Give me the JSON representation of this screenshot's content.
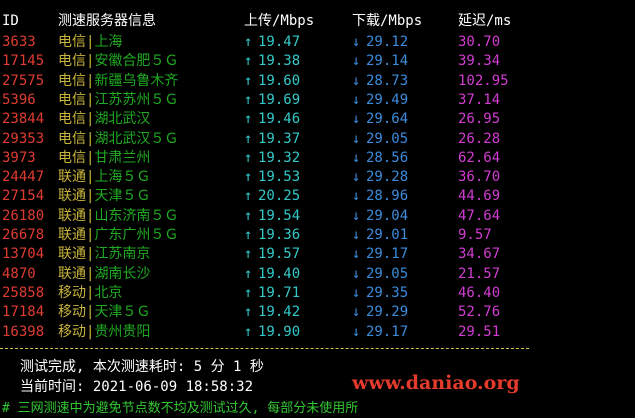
{
  "colors": {
    "background": "#000000",
    "header": "#ffffff",
    "id_red": "#e03c32",
    "isp_gold": "#c8b43c",
    "node_green": "#1faa22",
    "up_cyan": "#33c8c8",
    "down_blue": "#3c8cdc",
    "latency_magenta": "#d23cd2",
    "separator": "#d8c24a",
    "watermark": "#e53b2c",
    "note": "#33c833"
  },
  "header": {
    "id": "ID",
    "node": "测速服务器信息",
    "upload": "上传/Mbps",
    "download": "下载/Mbps",
    "latency": "延迟/ms"
  },
  "arrow_up": "↑",
  "arrow_down": "↓",
  "rows": [
    {
      "id": "3633",
      "isp": "电信",
      "sep": "|",
      "city": "上海",
      "up": "19.47",
      "down": "29.12",
      "latency": "30.70"
    },
    {
      "id": "17145",
      "isp": "电信",
      "sep": "|",
      "city": "安徽合肥５Ｇ",
      "up": "19.38",
      "down": "29.14",
      "latency": "39.34"
    },
    {
      "id": "27575",
      "isp": "电信",
      "sep": "|",
      "city": "新疆乌鲁木齐",
      "up": "19.60",
      "down": "28.73",
      "latency": "102.95"
    },
    {
      "id": "5396",
      "isp": "电信",
      "sep": "|",
      "city": "江苏苏州５Ｇ",
      "up": "19.69",
      "down": "29.49",
      "latency": "37.14"
    },
    {
      "id": "23844",
      "isp": "电信",
      "sep": "|",
      "city": "湖北武汉",
      "up": "19.46",
      "down": "29.64",
      "latency": "26.95"
    },
    {
      "id": "29353",
      "isp": "电信",
      "sep": "|",
      "city": "湖北武汉５Ｇ",
      "up": "19.37",
      "down": "29.05",
      "latency": "26.28"
    },
    {
      "id": "3973",
      "isp": "电信",
      "sep": "|",
      "city": "甘肃兰州",
      "up": "19.32",
      "down": "28.56",
      "latency": "62.64"
    },
    {
      "id": "24447",
      "isp": "联通",
      "sep": "|",
      "city": "上海５Ｇ",
      "up": "19.53",
      "down": "29.28",
      "latency": "36.70"
    },
    {
      "id": "27154",
      "isp": "联通",
      "sep": "|",
      "city": "天津５Ｇ",
      "up": "20.25",
      "down": "28.96",
      "latency": "44.69"
    },
    {
      "id": "26180",
      "isp": "联通",
      "sep": "|",
      "city": "山东济南５Ｇ",
      "up": "19.54",
      "down": "29.04",
      "latency": "47.64"
    },
    {
      "id": "26678",
      "isp": "联通",
      "sep": "|",
      "city": "广东广州５Ｇ",
      "up": "19.36",
      "down": "29.01",
      "latency": "9.57"
    },
    {
      "id": "13704",
      "isp": "联通",
      "sep": "|",
      "city": "江苏南京",
      "up": "19.57",
      "down": "29.17",
      "latency": "34.67"
    },
    {
      "id": "4870",
      "isp": "联通",
      "sep": "|",
      "city": "湖南长沙",
      "up": "19.40",
      "down": "29.05",
      "latency": "21.57"
    },
    {
      "id": "25858",
      "isp": "移动",
      "sep": "|",
      "city": "北京",
      "up": "19.71",
      "down": "29.35",
      "latency": "46.40"
    },
    {
      "id": "17184",
      "isp": "移动",
      "sep": "|",
      "city": "天津５Ｇ",
      "up": "19.42",
      "down": "29.29",
      "latency": "52.76"
    },
    {
      "id": "16398",
      "isp": "移动",
      "sep": "|",
      "city": "贵州贵阳",
      "up": "19.90",
      "down": "29.17",
      "latency": "29.51"
    }
  ],
  "summary": {
    "done": "测试完成, 本次测速耗时: 5 分 1 秒",
    "time": "当前时间: 2021-06-09 18:58:32"
  },
  "watermark": "www.daniao.org",
  "note": "# 三网测速中为避免节点数不均及测试过久, 每部分未使用所"
}
